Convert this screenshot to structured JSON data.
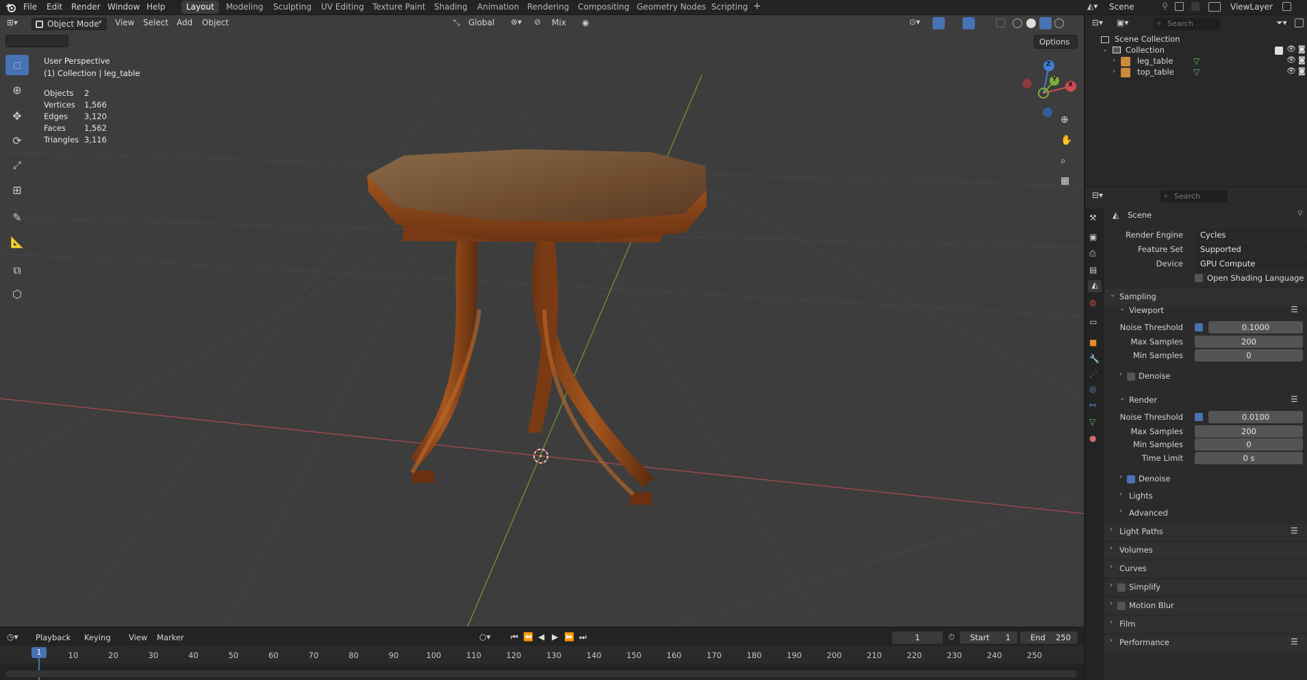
{
  "topbar": {
    "menu": [
      "File",
      "Edit",
      "Render",
      "Window",
      "Help"
    ],
    "workspaces": [
      "Layout",
      "Modeling",
      "Sculpting",
      "UV Editing",
      "Texture Paint",
      "Shading",
      "Animation",
      "Rendering",
      "Compositing",
      "Geometry Nodes",
      "Scripting"
    ],
    "add_workspace": "+",
    "scene_name": "Scene",
    "view_layer": "ViewLayer"
  },
  "viewport": {
    "mode": "Object Mode",
    "menu": [
      "View",
      "Select",
      "Add",
      "Object"
    ],
    "transform_orientation": "Global",
    "snap_mode": "Mix",
    "options_label": "Options",
    "overlay_title": "User Perspective",
    "overlay_subtitle": "(1) Collection | leg_table",
    "stats": [
      {
        "label": "Objects",
        "value": "2"
      },
      {
        "label": "Vertices",
        "value": "1,566"
      },
      {
        "label": "Edges",
        "value": "3,120"
      },
      {
        "label": "Faces",
        "value": "1,562"
      },
      {
        "label": "Triangles",
        "value": "3,116"
      }
    ],
    "gizmo": {
      "x": "X",
      "y": "Y",
      "z": "Z"
    },
    "axis_colors": {
      "x": "#d04a55",
      "y": "#7fae38",
      "z": "#3f7fd4"
    }
  },
  "outliner": {
    "search_placeholder": "Search",
    "root": "Scene Collection",
    "collection": "Collection",
    "objects": [
      "leg_table",
      "top_table"
    ]
  },
  "properties": {
    "search_placeholder": "Search",
    "context": "Scene",
    "render_engine_label": "Render Engine",
    "render_engine": "Cycles",
    "feature_set_label": "Feature Set",
    "feature_set": "Supported",
    "device_label": "Device",
    "device": "GPU Compute",
    "osl_label": "Open Shading Language",
    "sampling": "Sampling",
    "viewport_label": "Viewport",
    "noise_threshold_label": "Noise Threshold",
    "vp_noise": "0.1000",
    "max_samples_label": "Max Samples",
    "min_samples_label": "Min Samples",
    "vp_max": "200",
    "vp_min": "0",
    "denoise_label": "Denoise",
    "render_label": "Render",
    "r_noise": "0.0100",
    "r_max": "200",
    "r_min": "0",
    "time_limit_label": "Time Limit",
    "r_time": "0 s",
    "lights": "Lights",
    "advanced": "Advanced",
    "light_paths": "Light Paths",
    "volumes": "Volumes",
    "curves": "Curves",
    "simplify": "Simplify",
    "motion_blur": "Motion Blur",
    "film": "Film",
    "performance": "Performance"
  },
  "timeline": {
    "menu": [
      "Playback",
      "Keying",
      "View",
      "Marker"
    ],
    "current_frame": "1",
    "start_label": "Start",
    "start": "1",
    "end_label": "End",
    "end": "250",
    "ticks": [
      "1",
      "10",
      "20",
      "30",
      "40",
      "50",
      "60",
      "70",
      "80",
      "90",
      "100",
      "110",
      "120",
      "130",
      "140",
      "150",
      "160",
      "170",
      "180",
      "190",
      "200",
      "210",
      "220",
      "230",
      "240",
      "250"
    ]
  }
}
